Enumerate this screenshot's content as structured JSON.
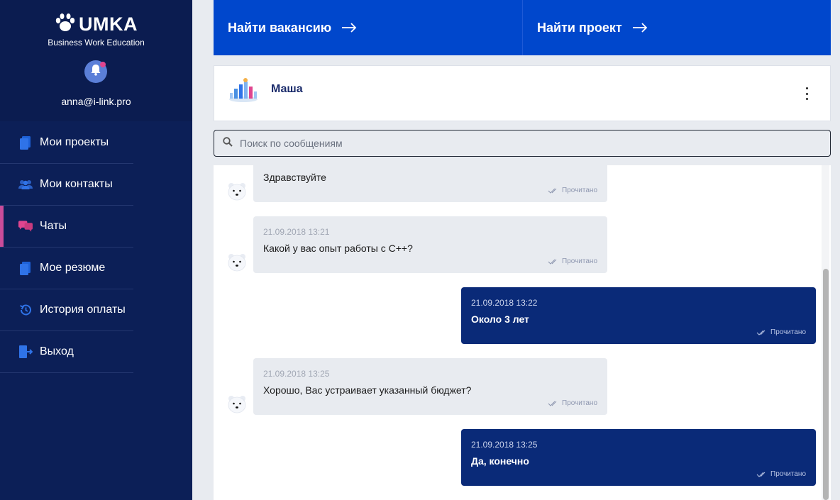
{
  "sidebar": {
    "logo_text": "UMKA",
    "logo_subtitle": "Business Work Education",
    "user_email": "anna@i-link.pro",
    "items": [
      {
        "label": "Мои проекты",
        "icon": "document-icon"
      },
      {
        "label": "Мои контакты",
        "icon": "people-icon"
      },
      {
        "label": "Чаты",
        "icon": "chat-icon",
        "active": true
      },
      {
        "label": "Мое резюме",
        "icon": "document-icon"
      },
      {
        "label": "История оплаты",
        "icon": "history-icon"
      },
      {
        "label": "Выход",
        "icon": "logout-icon"
      }
    ]
  },
  "topbar": {
    "find_vacancy": "Найти вакансию",
    "find_project": "Найти проект"
  },
  "chat": {
    "contact_name": "Маша",
    "search_placeholder": "Поиск по сообщениям",
    "messages": [
      {
        "direction": "in",
        "date": "",
        "text": "Здравствуйте",
        "status": "Прочитано"
      },
      {
        "direction": "in",
        "date": "21.09.2018 13:21",
        "text": "Какой у вас опыт работы с С++?",
        "status": "Прочитано"
      },
      {
        "direction": "out",
        "date": "21.09.2018 13:22",
        "text": "Около 3 лет",
        "status": "Прочитано"
      },
      {
        "direction": "in",
        "date": "21.09.2018 13:25",
        "text": "Хорошо, Вас устраивает указанный бюджет?",
        "status": "Прочитано"
      },
      {
        "direction": "out",
        "date": "21.09.2018 13:25",
        "text": "Да, конечно",
        "status": "Прочитано"
      }
    ]
  },
  "colors": {
    "sidebar_bg": "#0c1f57",
    "topbar_bg": "#0047cc",
    "outgoing_bubble": "#0a2a78",
    "incoming_bubble": "#e8ebf0",
    "active_accent": "#c94c9a"
  }
}
